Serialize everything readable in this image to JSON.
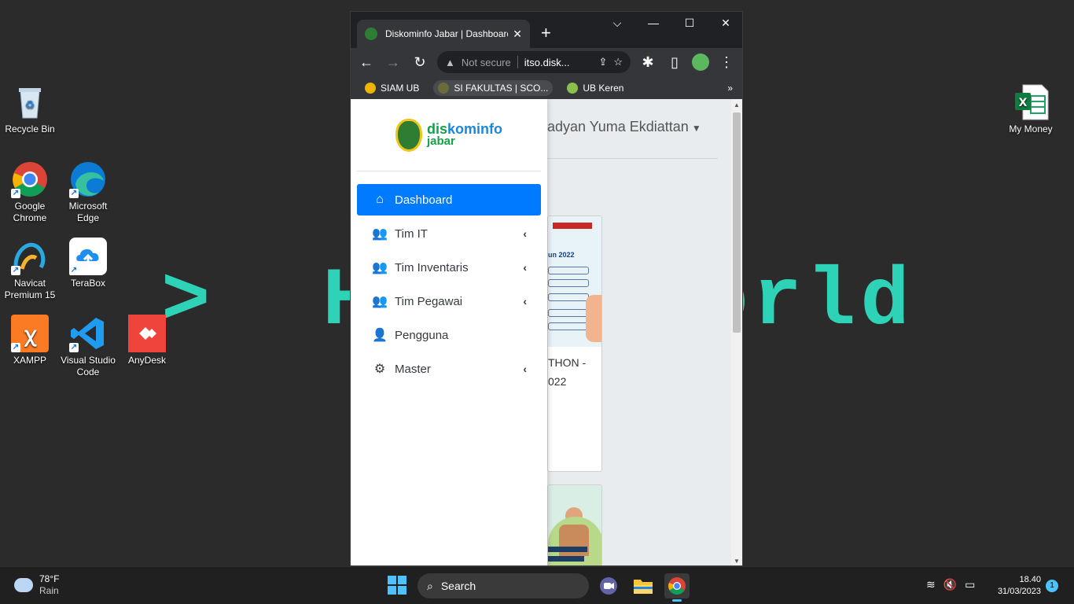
{
  "wallpaper": {
    "text": ">  Hello World"
  },
  "desktop_icons": [
    {
      "label": "Recycle Bin"
    },
    {
      "label": "Google Chrome"
    },
    {
      "label": "Microsoft Edge"
    },
    {
      "label": "Navicat Premium 15"
    },
    {
      "label": "TeraBox"
    },
    {
      "label": "XAMPP"
    },
    {
      "label": "Visual Studio Code"
    },
    {
      "label": "AnyDesk"
    },
    {
      "label": "My Money"
    }
  ],
  "browser": {
    "tab_title": "Diskominfo Jabar | Dashboard",
    "security_label": "Not secure",
    "url": "itso.disk...",
    "bookmarks": [
      {
        "label": "SIAM UB"
      },
      {
        "label": "SI FAKULTAS | SCO..."
      },
      {
        "label": "UB Keren"
      }
    ]
  },
  "page": {
    "logo": {
      "line1_a": "dis",
      "line1_b": "kominfo",
      "line2": "jabar"
    },
    "user_name": "adyan Yuma Ekdiattan",
    "menu": [
      {
        "label": "Dashboard",
        "icon": "home-icon",
        "active": true
      },
      {
        "label": "Tim IT",
        "icon": "users-icon"
      },
      {
        "label": "Tim Inventaris",
        "icon": "users-icon"
      },
      {
        "label": "Tim Pegawai",
        "icon": "users-icon"
      },
      {
        "label": "Pengguna",
        "icon": "user-plus-icon"
      },
      {
        "label": "Master",
        "icon": "gear-icon"
      }
    ],
    "card1": {
      "caption_line1": "THON -",
      "caption_line2": "022",
      "poster_text": "un 2022"
    }
  },
  "taskbar": {
    "weather_temp": "78°F",
    "weather_desc": "Rain",
    "search_label": "Search",
    "time": "18.40",
    "date": "31/03/2023",
    "notifications": "1"
  },
  "colors": {
    "accent": "#007bff",
    "wallpaper_text": "#2ed3b7",
    "taskbar_accent": "#4cc2ff"
  }
}
